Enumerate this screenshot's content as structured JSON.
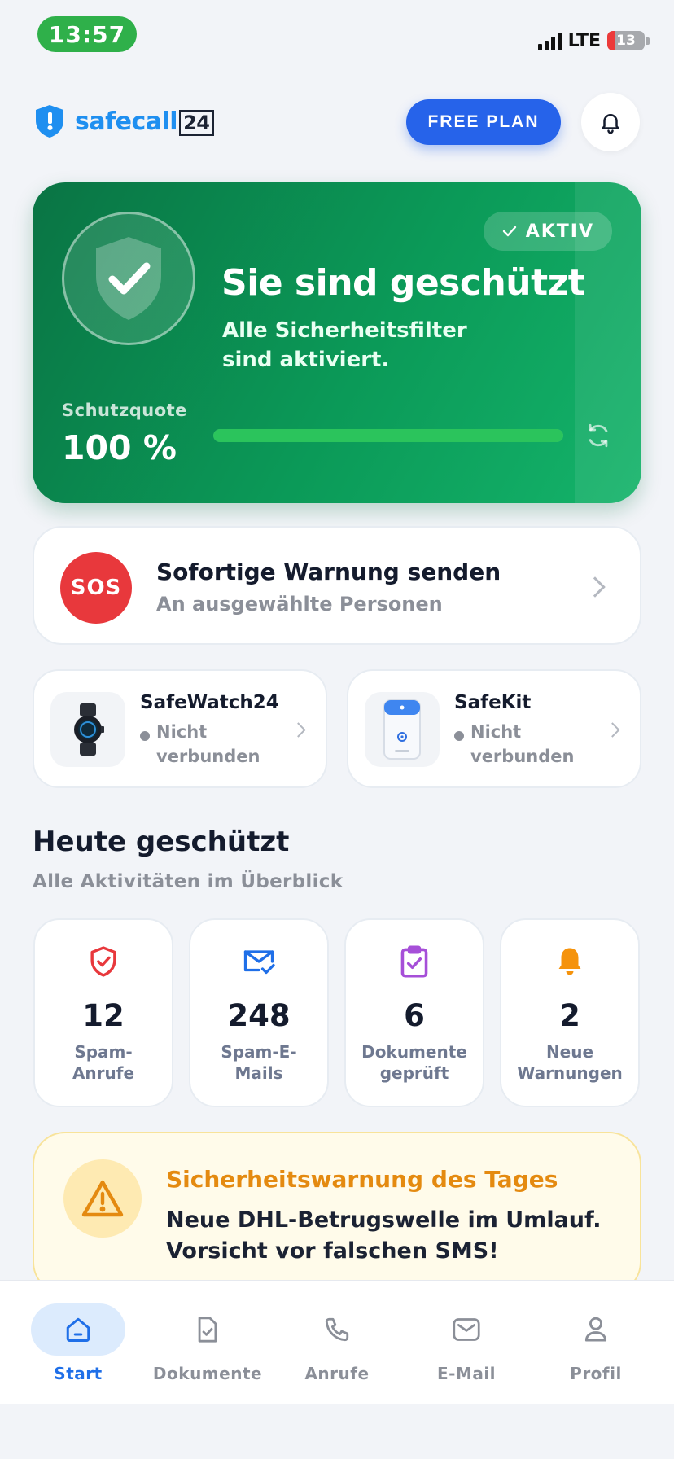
{
  "status_bar": {
    "time": "13:57",
    "network": "LTE",
    "battery": "13"
  },
  "header": {
    "logo_safe": "safe",
    "logo_call": "call",
    "logo_24": "24",
    "plan_button": "FREE PLAN",
    "notifications_icon": "bell-icon"
  },
  "hero": {
    "badge": "AKTIV",
    "title": "Sie sind geschützt",
    "subtitle": "Alle Sicherheitsfilter sind aktiviert.",
    "quota_label": "Schutzquote",
    "quota_value": "100 %",
    "quota_fraction": 1.0,
    "color_accent": "#0b9a58"
  },
  "sos": {
    "badge": "SOS",
    "title": "Sofortige Warnung senden",
    "subtitle": "An ausgewählte Personen",
    "color": "#e8383c"
  },
  "devices": [
    {
      "name": "SafeWatch24",
      "status": "Nicht verbunden",
      "icon": "watch-icon"
    },
    {
      "name": "SafeKit",
      "status": "Nicht verbunden",
      "icon": "safekit-device-icon"
    }
  ],
  "today": {
    "title": "Heute geschützt",
    "subtitle": "Alle Aktivitäten im Überblick",
    "stats": [
      {
        "value": "12",
        "label": "Spam-Anrufe",
        "icon": "shield-check-icon",
        "color": "#e8383c"
      },
      {
        "value": "248",
        "label": "Spam-E-Mails",
        "icon": "mail-check-icon",
        "color": "#1f6fe8"
      },
      {
        "value": "6",
        "label": "Dokumente geprüft",
        "icon": "clipboard-check-icon",
        "color": "#a64fd8"
      },
      {
        "value": "2",
        "label": "Neue Warnungen",
        "icon": "bell-icon",
        "color": "#f5930c"
      }
    ]
  },
  "warning": {
    "title": "Sicherheitswarnung des Tages",
    "text": "Neue DHL-Betrugswelle im Umlauf. Vorsicht vor falschen SMS!",
    "color": "#e48a10"
  },
  "tabs": [
    {
      "label": "Start",
      "icon": "home-icon",
      "active": true
    },
    {
      "label": "Dokumente",
      "icon": "document-icon",
      "active": false
    },
    {
      "label": "Anrufe",
      "icon": "phone-icon",
      "active": false
    },
    {
      "label": "E-Mail",
      "icon": "mail-icon",
      "active": false
    },
    {
      "label": "Profil",
      "icon": "user-icon",
      "active": false
    }
  ]
}
